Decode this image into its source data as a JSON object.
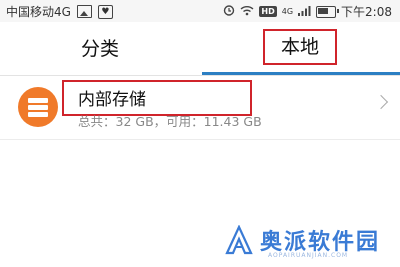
{
  "status_bar": {
    "carrier": "中国移动4G",
    "hd_badge": "HD",
    "network": "4G",
    "time": "下午2:08"
  },
  "tabs": [
    {
      "label": "分类"
    },
    {
      "label": "本地"
    }
  ],
  "storage": {
    "title": "内部存储",
    "detail": "总共：32 GB，可用：11.43 GB"
  },
  "watermark": {
    "name": "奥派软件园",
    "url": "AOPAIRUANJIAN.COM"
  },
  "colors": {
    "accent": "#2c7fc3",
    "storage_icon": "#f07a2a",
    "highlight": "#d0242b"
  }
}
